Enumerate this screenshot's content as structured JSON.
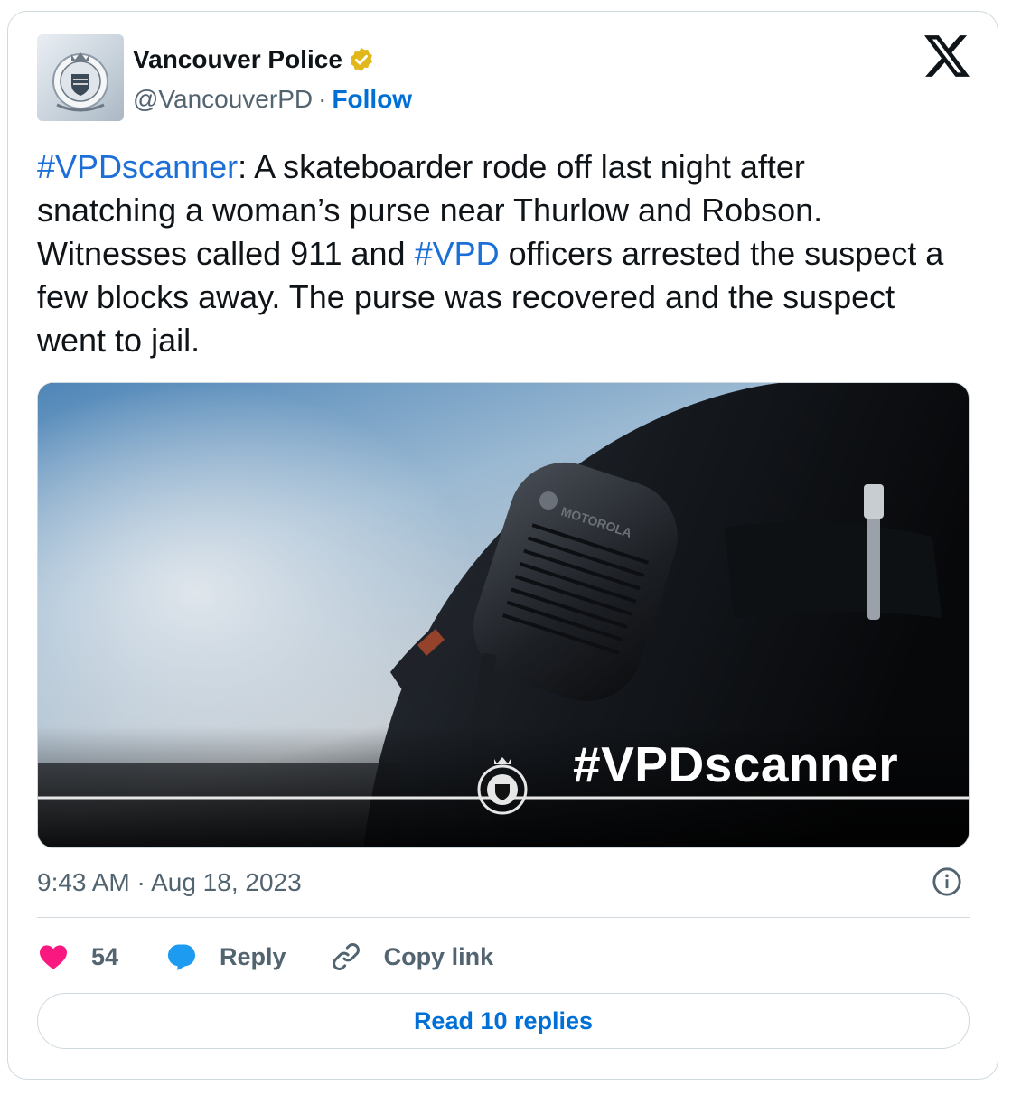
{
  "header": {
    "account_name": "Vancouver Police",
    "handle": "@VancouverPD",
    "separator": "·",
    "follow_label": "Follow",
    "avatar_icon": "vpd-crest-icon",
    "verified_icon": "verified-badge-icon",
    "platform_icon": "x-logo-icon"
  },
  "tweet": {
    "hashtag_1": "#VPDscanner",
    "text_1": ": A skateboarder rode off last night after snatching a woman’s purse near Thurlow and Robson. Witnesses called 911 and ",
    "hashtag_2": "#VPD",
    "text_2": " officers arrested the suspect a few blocks away. The purse was recovered and the suspect went to jail."
  },
  "media": {
    "overlay_text": "#VPDscanner",
    "radio_brand": "MOTOROLA"
  },
  "meta": {
    "timestamp": "9:43 AM · Aug 18, 2023",
    "info_icon": "info-icon"
  },
  "actions": {
    "like_count": "54",
    "reply_label": "Reply",
    "copy_link_label": "Copy link"
  },
  "footer": {
    "read_replies_label": "Read 10 replies"
  },
  "colors": {
    "link_blue": "#006fd6",
    "hashtag_blue": "#1d6fd8",
    "like_pink": "#f91880",
    "reply_blue": "#1d9bf0",
    "verified_gold": "#e2b719",
    "muted_gray": "#536471",
    "border": "#cfd9de"
  }
}
